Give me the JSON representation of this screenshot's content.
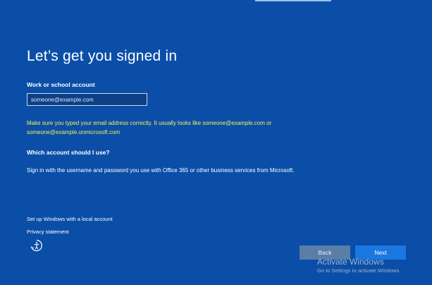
{
  "title": "Let’s get you signed in",
  "account_field": {
    "label": "Work or school account",
    "placeholder": "someone@example.com"
  },
  "error_message": "Make sure you typed your email address correctly. It usually looks like someone@example.com or someone@example.onmicrosoft.com",
  "which_account": {
    "heading": "Which account should I use?",
    "description": "Sign in with the username and password you use with Office 365 or other business services from Microsoft."
  },
  "links": {
    "local_account": "Set up Windows with a local account",
    "privacy": "Privacy statement"
  },
  "buttons": {
    "back": "Back",
    "next": "Next"
  },
  "watermark": {
    "title": "Activate Windows",
    "subtitle": "Go to Settings to activate Windows."
  },
  "icons": {
    "accessibility": "ease-of-access-icon"
  },
  "colors": {
    "background": "#0b4ea8",
    "error": "#f4f05a",
    "next_button": "#1a78e0",
    "back_button": "#5a7ea8"
  }
}
